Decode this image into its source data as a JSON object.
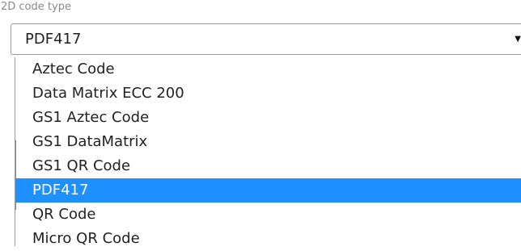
{
  "field": {
    "label": "2D code type",
    "selected_value": "PDF417",
    "arrow_icon": "dropdown-arrow-icon"
  },
  "dropdown": {
    "options": [
      {
        "label": "Aztec Code",
        "selected": false
      },
      {
        "label": "Data Matrix ECC 200",
        "selected": false
      },
      {
        "label": "GS1 Aztec Code",
        "selected": false
      },
      {
        "label": "GS1 DataMatrix",
        "selected": false
      },
      {
        "label": "GS1 QR Code",
        "selected": false
      },
      {
        "label": "PDF417",
        "selected": true
      },
      {
        "label": "QR Code",
        "selected": false
      },
      {
        "label": "Micro QR Code",
        "selected": false
      }
    ]
  },
  "colors": {
    "highlight": "#1e90ff",
    "highlight_text": "#ffffff",
    "text": "#222222",
    "label": "#8a8a8a"
  }
}
